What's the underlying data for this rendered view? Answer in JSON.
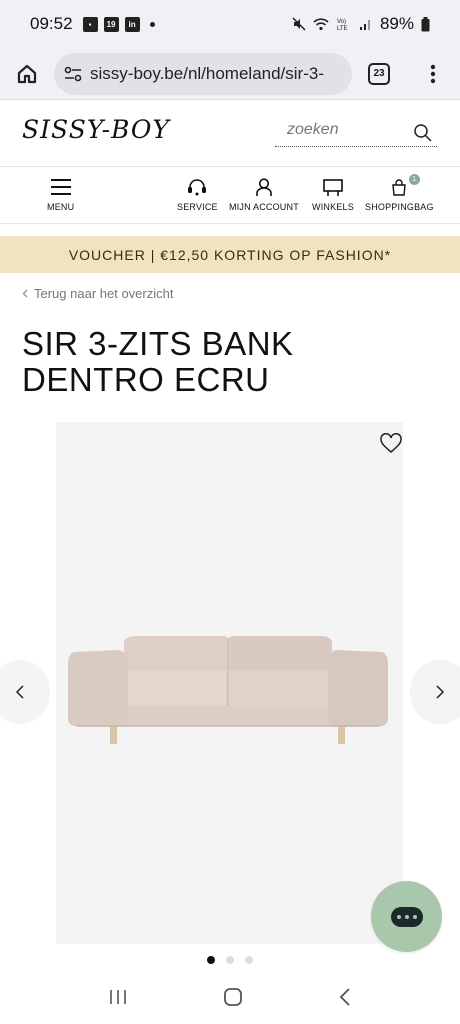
{
  "status_bar": {
    "time": "09:52",
    "notif_badge": "19",
    "linkedin": "in",
    "battery": "89%"
  },
  "browser": {
    "url": "sissy-boy.be/nl/homeland/sir-3-",
    "tab_count": "23"
  },
  "site": {
    "logo": "SISSY-BOY",
    "search_placeholder": "zoeken"
  },
  "nav": {
    "menu": "MENU",
    "service": "SERVICE",
    "account": "MIJN ACCOUNT",
    "stores": "WINKELS",
    "bag": "SHOPPINGBAG",
    "bag_count": "1"
  },
  "voucher": "VOUCHER | €12,50 KORTING OP FASHION*",
  "breadcrumb": "Terug naar het overzicht",
  "product": {
    "title": "SIR 3-ZITS BANK DENTRO ECRU"
  },
  "carousel": {
    "total": 3,
    "active": 1
  },
  "colors": {
    "voucher_bg": "#f3e2bf",
    "chat_bg": "#a9c8ab",
    "badge": "#8fa89c"
  }
}
